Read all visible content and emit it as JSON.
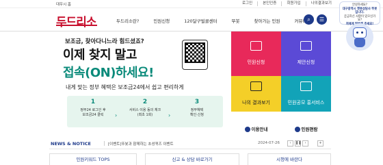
{
  "topbar": {
    "lang": "대우시 홈",
    "utility": [
      "로그인",
      "본인인증",
      "회원가입",
      "나의결과보기"
    ]
  },
  "header": {
    "logo": "두드리소",
    "nav": [
      "두드리소란?",
      "민원신청",
      "120달구벌콜센터",
      "뚜봇",
      "찾아가는 민원",
      "커뮤니티"
    ]
  },
  "banner": {
    "subtitle": "보조금, 찾아다니느라 힘드셨죠?",
    "title_line1": "이제 찾지 말고",
    "title_line2": "접속(ON)하세요!",
    "description": "내게 맞는 정부 혜택은 보조금24에서 쉽고 편리하게",
    "steps": [
      {
        "num": "1",
        "line1": "정부24 로그인 후",
        "line2": "보조금24 클릭"
      },
      {
        "num": "2",
        "line1": "서비스 이용 동의 체크",
        "line2": "(최초 1회)"
      },
      {
        "num": "3",
        "line1": "정부혜택",
        "line2": "확인·신청"
      }
    ]
  },
  "tiles": {
    "apply": "민원신청",
    "propose": "제안신청",
    "my_results": "나의 결과보기",
    "showcase": "민원공모 홍서비스",
    "usage_guide": "이용안내",
    "handbook": "민원편람"
  },
  "news": {
    "title": "NEWS & NOTICE",
    "headline": "[이벤트]뚜봇과 함께하는 초성퀴즈 이벤트",
    "date": "2024-07-26"
  },
  "bottom": {
    "col1": "민원키워드 TOPS",
    "col2": "신고 & 상담 바로가기",
    "col3": "시청에 바란다"
  },
  "chatbot": {
    "line1": "안녕하세요?",
    "line2": "대구광역시 챗봇상담사 뚜봇입니다.",
    "line3": "궁금하신 사항이 있으신가요?",
    "line4": "저에게 말씀해 주세요!"
  },
  "colors": {
    "brand": "#c8102e",
    "navy": "#1e3a8a",
    "teal": "#0a8a7a",
    "tile_apply": "#e8295a",
    "tile_propose": "#5b4ad6",
    "tile_results": "#f4cf28",
    "tile_showcase": "#12a3b8"
  }
}
